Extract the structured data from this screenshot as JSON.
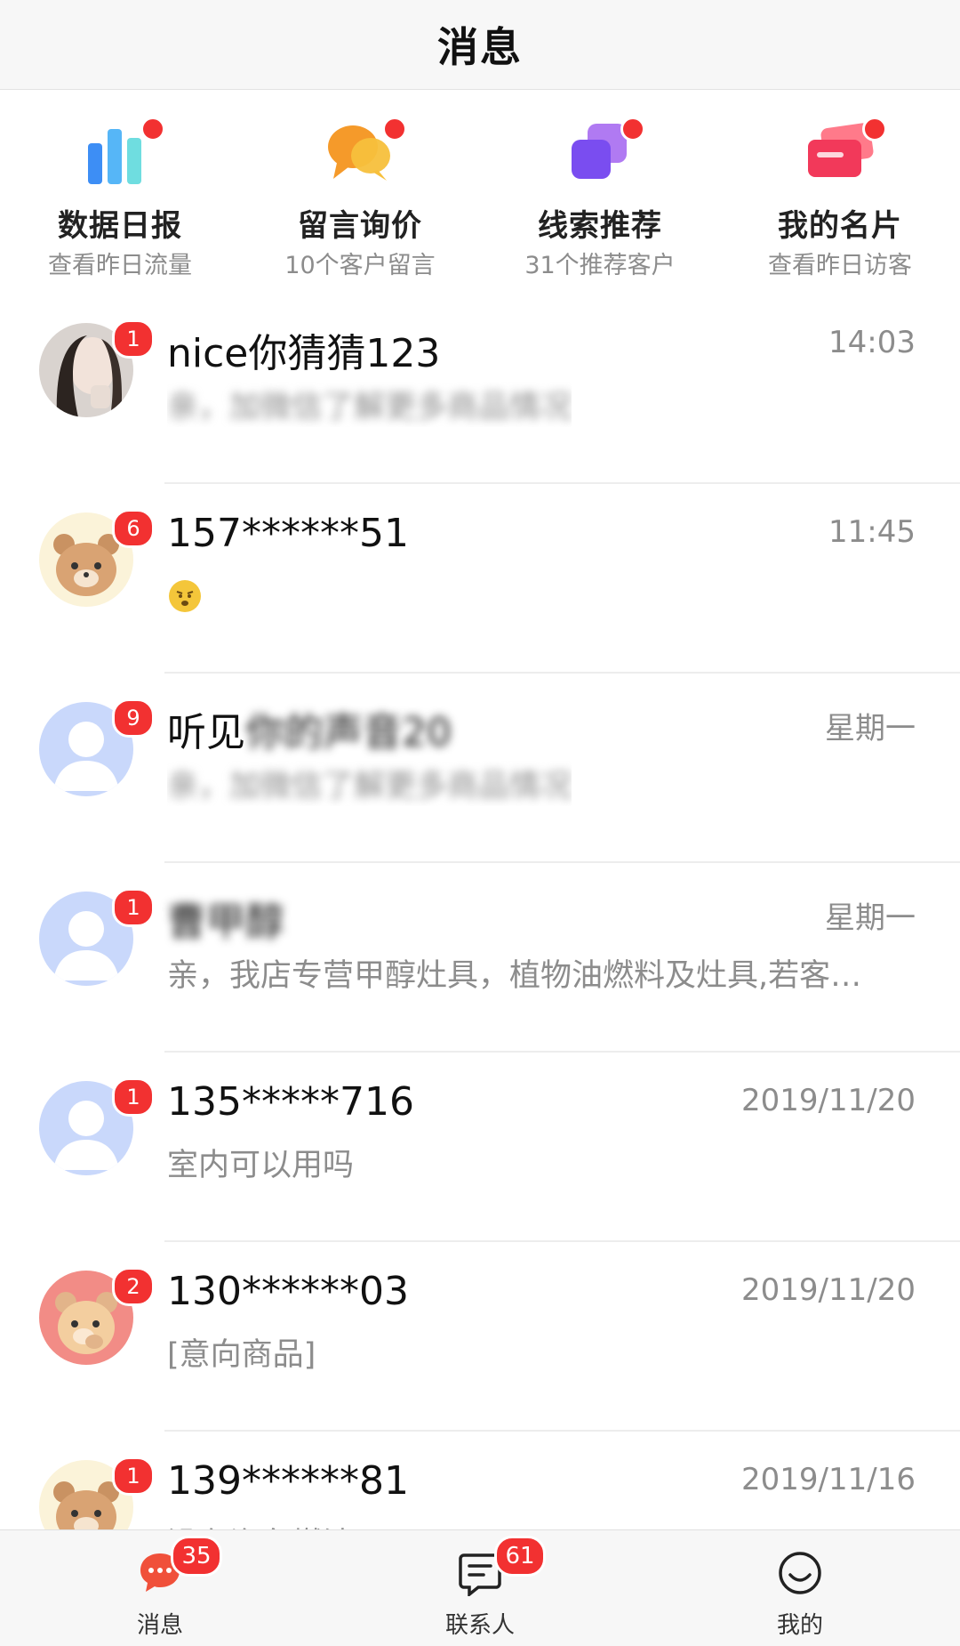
{
  "header": {
    "title": "消息"
  },
  "quick_entries": [
    {
      "title": "数据日报",
      "subtitle": "查看昨日流量",
      "icon": "bar-chart-icon"
    },
    {
      "title": "留言询价",
      "subtitle": "10个客户留言",
      "icon": "chat-bubbles-icon"
    },
    {
      "title": "线索推荐",
      "subtitle": "31个推荐客户",
      "icon": "stacked-cards-icon"
    },
    {
      "title": "我的名片",
      "subtitle": "查看昨日访客",
      "icon": "business-card-icon"
    }
  ],
  "conversations": [
    {
      "name": "nice你猜猜123",
      "time": "14:03",
      "badge": "1",
      "preview": "亲，加微信了解更多商品情况",
      "avatar": "photo-avatar"
    },
    {
      "name": "157******51",
      "time": "11:45",
      "badge": "6",
      "preview": "",
      "preview_icon": "emoji-icon",
      "avatar": "bear-avatar"
    },
    {
      "name": "听见",
      "name_blurred": "你的声音20",
      "time": "星期一",
      "badge": "9",
      "preview": "亲，加微信了解更多商品情况",
      "avatar": "default-avatar"
    },
    {
      "name": "",
      "name_blurred": "曹甲醇",
      "time": "星期一",
      "badge": "1",
      "preview": "亲，我店专营甲醇灶具，植物油燃料及灶具,若客…",
      "avatar": "default-avatar"
    },
    {
      "name": "135*****716",
      "time": "2019/11/20",
      "badge": "1",
      "preview": "室内可以用吗",
      "avatar": "default-avatar"
    },
    {
      "name": "130******03",
      "time": "2019/11/20",
      "badge": "2",
      "preview": "[意向商品]",
      "avatar": "bear-pink-avatar"
    },
    {
      "name": "139******81",
      "time": "2019/11/16",
      "badge": "1",
      "preview": "没有汽车燃油",
      "avatar": "bear-avatar"
    }
  ],
  "tabbar": [
    {
      "label": "消息",
      "badge": "35",
      "icon": "message-icon",
      "active": true
    },
    {
      "label": "联系人",
      "badge": "61",
      "icon": "contacts-icon",
      "active": false
    },
    {
      "label": "我的",
      "badge": "",
      "icon": "smile-icon",
      "active": false
    }
  ],
  "colors": {
    "badge": "#f23131",
    "accent_red": "#f0503a",
    "muted_text": "#8c8c8c"
  }
}
